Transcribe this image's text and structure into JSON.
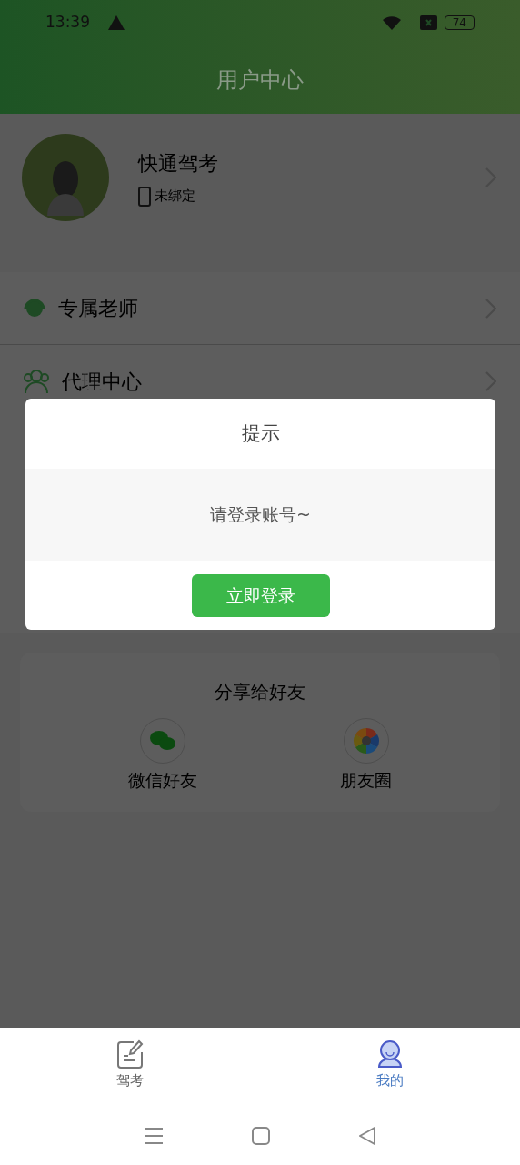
{
  "status_bar": {
    "time": "13:39",
    "battery": "74"
  },
  "header": {
    "title": "用户中心"
  },
  "profile": {
    "name": "快通驾考",
    "phone_status": "未绑定"
  },
  "menu": [
    {
      "label": "专属老师",
      "kind": "teacher"
    },
    {
      "label": "代理中心",
      "kind": "agent"
    }
  ],
  "share": {
    "title": "分享给好友",
    "options": [
      {
        "label": "微信好友",
        "kind": "wechat"
      },
      {
        "label": "朋友圈",
        "kind": "moments"
      }
    ]
  },
  "dialog": {
    "title": "提示",
    "message": "请登录账号~",
    "button": "立即登录"
  },
  "tabs": [
    {
      "label": "驾考",
      "kind": "exam",
      "selected": false
    },
    {
      "label": "我的",
      "kind": "me",
      "selected": true
    }
  ]
}
